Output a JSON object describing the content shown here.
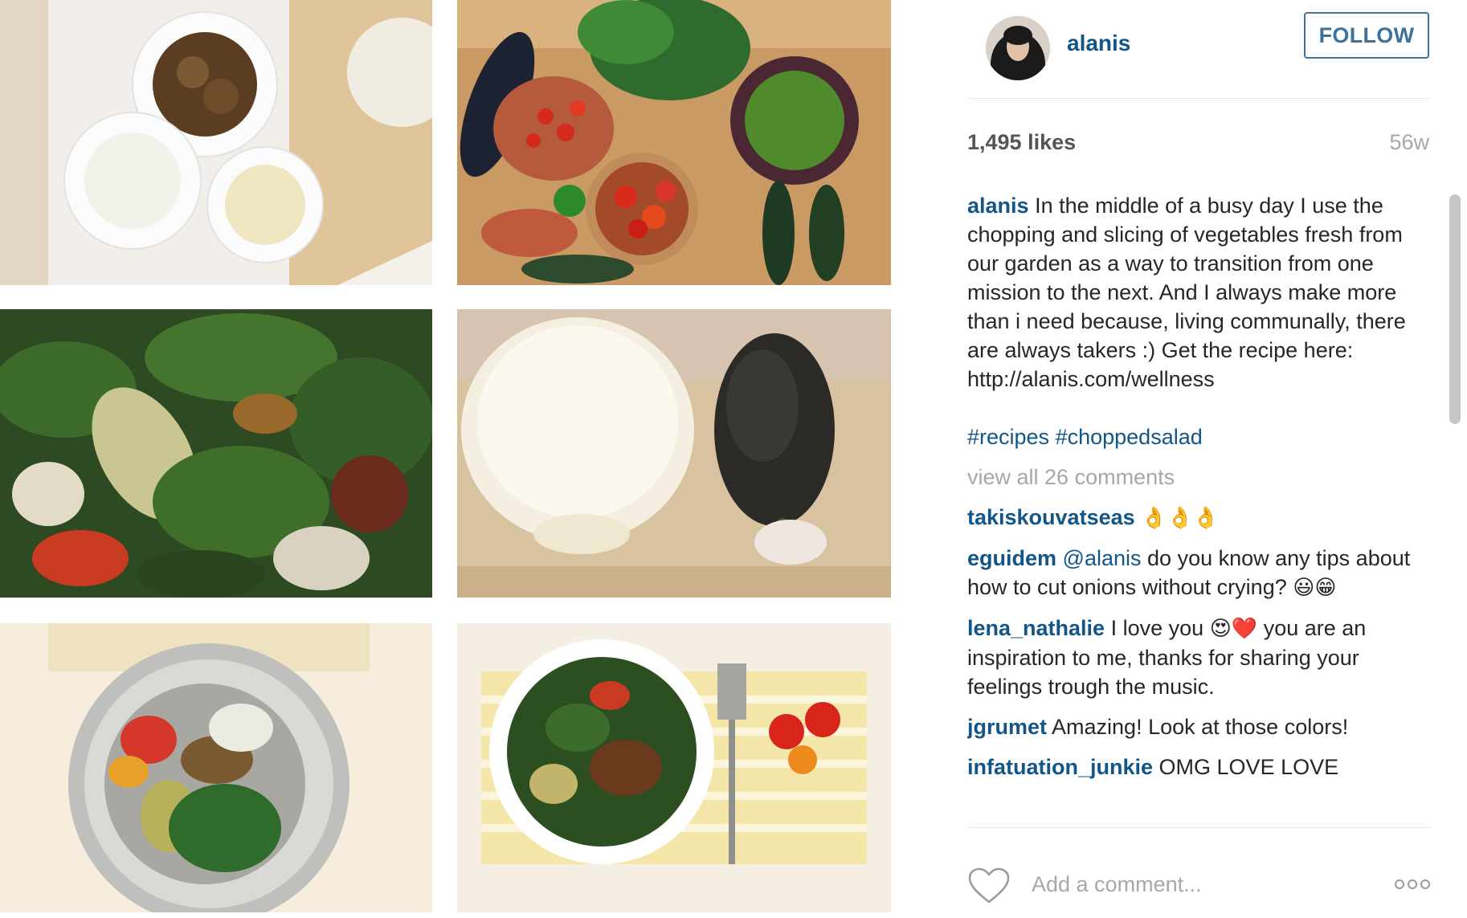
{
  "post": {
    "username": "alanis",
    "follow_label": "FOLLOW",
    "likes": "1,495 likes",
    "age": "56w",
    "caption_user": "alanis",
    "caption_text": "In the middle of a busy day I use the chopping and slicing of vegetables fresh from our garden as a way to transition from one mission to the next. And I always make more than i need because, living communally, there are always takers :) Get the recipe here: http://alanis.com/wellness",
    "hashtags": [
      "#recipes",
      "#choppedsalad"
    ],
    "view_all_label": "view all 26 comments",
    "comments": [
      {
        "user": "takiskouvatseas",
        "text": "👌👌👌"
      },
      {
        "user": "eguidem",
        "mention": "@alanis",
        "text": "do you know any tips about how to cut onions without crying?",
        "emoji": "😃😁"
      },
      {
        "user": "lena_nathalie",
        "text_before": "I love you",
        "emoji": "😍❤️",
        "text_after": "you are an inspiration to me, thanks for sharing your feelings trough the music."
      },
      {
        "user": "jgrumet",
        "text": "Amazing! Look at those colors!"
      },
      {
        "user": "infatuation_junkie",
        "text": "OMG LOVE LOVE"
      }
    ],
    "comment_placeholder": "Add a comment...",
    "more_icon": "more-options-icon",
    "heart_icon": "heart-icon"
  },
  "colors": {
    "link": "#125688",
    "button": "#3f729b",
    "muted": "#a5a7aa"
  }
}
